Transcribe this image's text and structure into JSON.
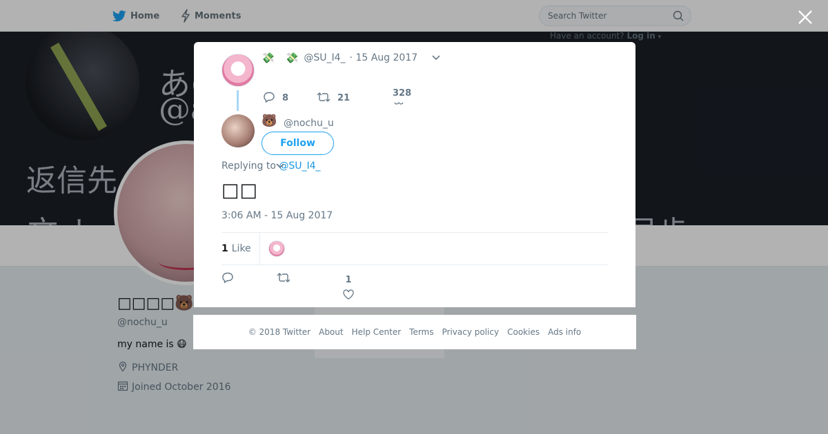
{
  "topbar": {
    "home_label": "Home",
    "moments_label": "Moments",
    "search_placeholder": "Search Twitter",
    "have_account": "Have an account?",
    "login_label": "Log in"
  },
  "banner": {
    "text1": "あの",
    "text2": "@a",
    "text3": "返信先",
    "text4": "文 ト",
    "text5": "号歩"
  },
  "profile": {
    "name": "□□□□",
    "name_emoji": "🐻",
    "handle": "@nochu_u",
    "bio": "my name is 😷",
    "location": "PHYNDER",
    "joined": "Joined October 2016"
  },
  "parent_tweet": {
    "emoji_a": "💸",
    "emoji_b": "💸",
    "handle": "@SU_I4_",
    "date": "· 15 Aug 2017",
    "replies": "8",
    "retweets": "21",
    "likes": "328"
  },
  "tweet": {
    "name_emoji": "🐻",
    "handle": "@nochu_u",
    "follow_label": "Follow",
    "replying_to_label": "Replying to",
    "replying_to_handle": "@SU_I4_",
    "text": "□□",
    "timestamp": "3:06 AM - 15 Aug 2017",
    "like_count": "1",
    "like_word": "Like",
    "action_like_count": "1"
  },
  "footer": {
    "copyright": "© 2018 Twitter",
    "about": "About",
    "help": "Help Center",
    "terms": "Terms",
    "privacy": "Privacy policy",
    "cookies": "Cookies",
    "ads": "Ads info"
  },
  "colors": {
    "accent": "#1da1f2",
    "link": "#1b95e0",
    "muted": "#657786"
  }
}
